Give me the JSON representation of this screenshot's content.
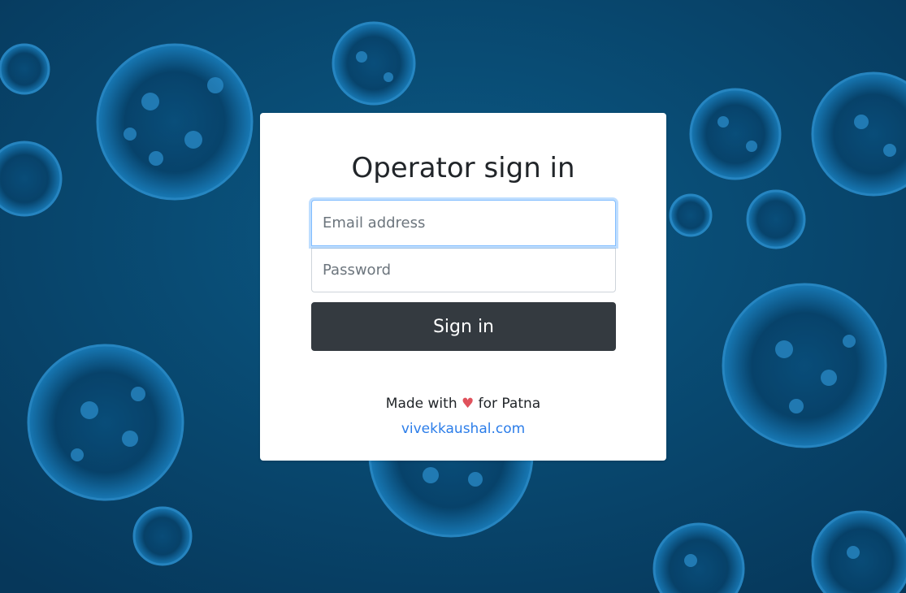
{
  "login": {
    "title": "Operator sign in",
    "email_placeholder": "Email address",
    "password_placeholder": "Password",
    "submit_label": "Sign in"
  },
  "footer": {
    "made_with": "Made with",
    "heart_icon": "heart-icon",
    "for_text": "for Patna",
    "link_text": "vivekkaushal.com"
  },
  "colors": {
    "background": "#08466e",
    "button": "#343a40",
    "link": "#2b7de9",
    "heart": "#e0525c"
  }
}
